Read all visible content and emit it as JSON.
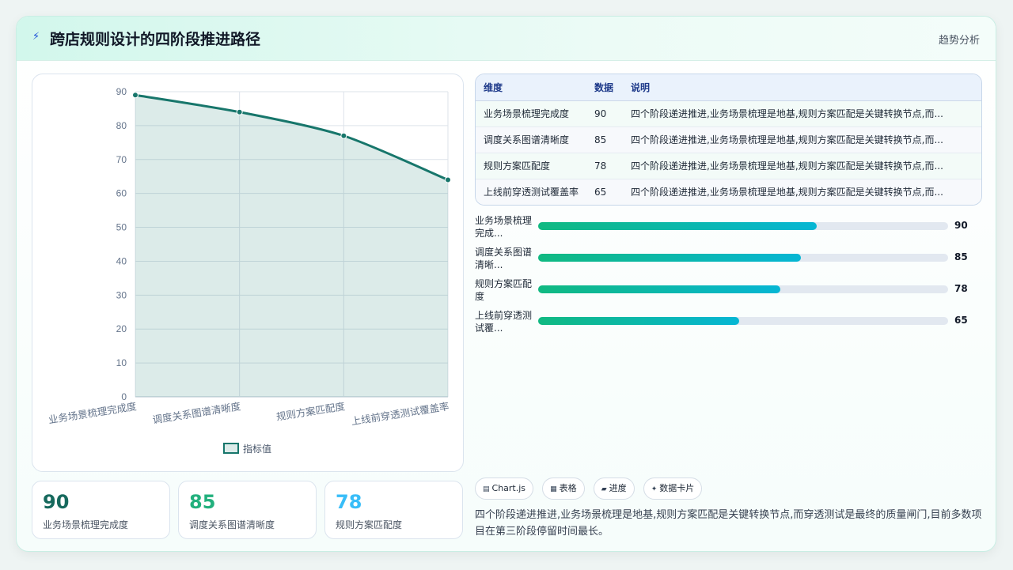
{
  "header": {
    "icon": "bolt-icon",
    "title": "跨店规则设计的四阶段推进路径",
    "badge": "趋势分析"
  },
  "chart_data": {
    "type": "line",
    "categories": [
      "业务场景梳理完成度",
      "调度关系图谱清晰度",
      "规则方案匹配度",
      "上线前穿透测试覆盖率"
    ],
    "series": [
      {
        "name": "指标值",
        "values": [
          89,
          84,
          77,
          64
        ]
      }
    ],
    "ylim": [
      0,
      90
    ],
    "yticks": [
      0,
      10,
      20,
      30,
      40,
      50,
      60,
      70,
      80,
      90
    ],
    "area_fill": true,
    "grid": true,
    "legend": "bottom",
    "colors": {
      "line": "#17766b",
      "fill": "rgba(23,118,107,0.15)"
    }
  },
  "stats": [
    {
      "value": "90",
      "label": "业务场景梳理完成度",
      "color": "#16695d"
    },
    {
      "value": "85",
      "label": "调度关系图谱清晰度",
      "color": "#22b07d"
    },
    {
      "value": "78",
      "label": "规则方案匹配度",
      "color": "#38bdf8"
    }
  ],
  "table": {
    "headers": [
      "维度",
      "数据",
      "说明"
    ],
    "rows": [
      [
        "业务场景梳理完成度",
        "90",
        "四个阶段递进推进,业务场景梳理是地基,规则方案匹配是关键转换节点,而..."
      ],
      [
        "调度关系图谱清晰度",
        "85",
        "四个阶段递进推进,业务场景梳理是地基,规则方案匹配是关键转换节点,而..."
      ],
      [
        "规则方案匹配度",
        "78",
        "四个阶段递进推进,业务场景梳理是地基,规则方案匹配是关键转换节点,而..."
      ],
      [
        "上线前穿透测试覆盖率",
        "65",
        "四个阶段递进推进,业务场景梳理是地基,规则方案匹配是关键转换节点,而..."
      ]
    ]
  },
  "progress": [
    {
      "label": "业务场景梳理完成...",
      "value": 90,
      "fill_fraction": 0.68
    },
    {
      "label": "调度关系图谱清晰...",
      "value": 85,
      "fill_fraction": 0.64
    },
    {
      "label": "规则方案匹配度",
      "value": 78,
      "fill_fraction": 0.59
    },
    {
      "label": "上线前穿透测试覆...",
      "value": 65,
      "fill_fraction": 0.49
    }
  ],
  "chips": [
    {
      "icon": "chart-icon",
      "label": "Chart.js"
    },
    {
      "icon": "table-icon",
      "label": "表格"
    },
    {
      "icon": "progress-icon",
      "label": "进度"
    },
    {
      "icon": "sparkle-icon",
      "label": "数据卡片"
    }
  ],
  "description": "四个阶段递进推进,业务场景梳理是地基,规则方案匹配是关键转换节点,而穿透测试是最终的质量闸门,目前多数项目在第三阶段停留时间最长。"
}
